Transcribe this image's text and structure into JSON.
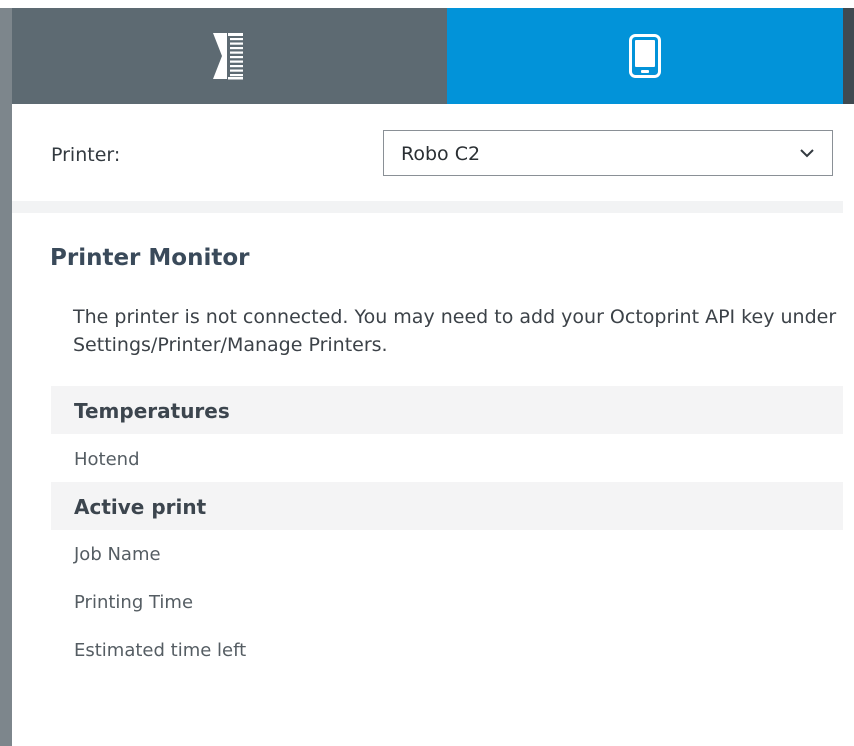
{
  "tabs": [
    {
      "name": "prepare",
      "icon": "layer-slicer-icon",
      "active": false
    },
    {
      "name": "monitor",
      "icon": "tablet-device-icon",
      "active": true
    }
  ],
  "colors": {
    "tab_inactive": "#5d6a72",
    "tab_active": "#0293d9",
    "left_border": "#7d868c",
    "section_header_bg": "#f4f4f5"
  },
  "printer": {
    "label": "Printer:",
    "selected": "Robo C2"
  },
  "monitor": {
    "title": "Printer Monitor",
    "notice": "The printer is not connected. You may need to add your Octoprint API key under Settings/Printer/Manage Printers.",
    "temperatures": {
      "header": "Temperatures",
      "rows": [
        "Hotend"
      ]
    },
    "active_print": {
      "header": "Active print",
      "rows": [
        "Job Name",
        "Printing Time",
        "Estimated time left"
      ]
    }
  }
}
